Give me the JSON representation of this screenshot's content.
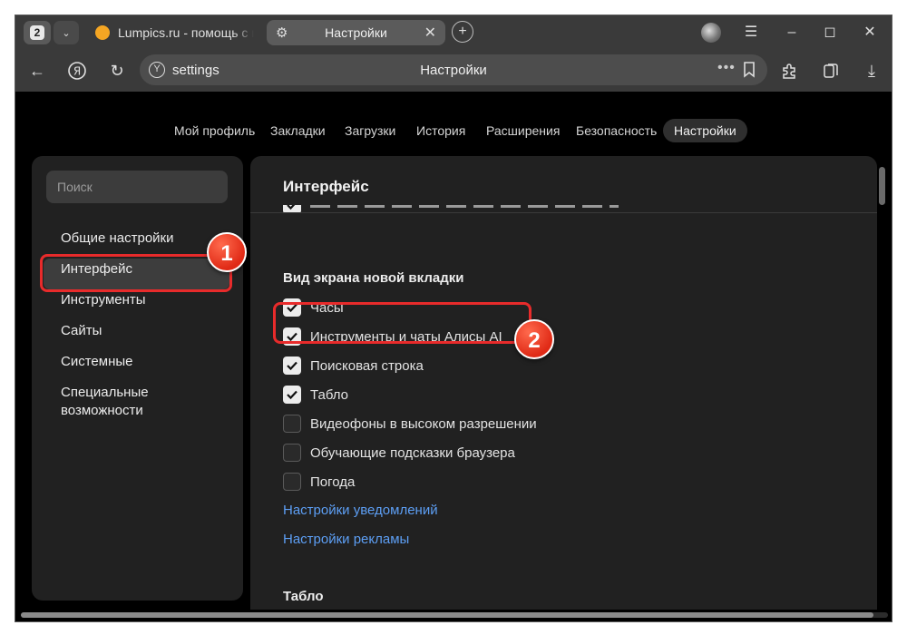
{
  "browser": {
    "tab_count": "2",
    "tabs": [
      {
        "title": "Lumpics.ru - помощь с компьютером",
        "active": false
      },
      {
        "title": "Настройки",
        "active": true
      }
    ],
    "address": {
      "url": "settings",
      "page_title": "Настройки"
    }
  },
  "settings_nav": [
    "Мой профиль",
    "Закладки",
    "Загрузки",
    "История",
    "Расширения",
    "Безопасность",
    "Настройки"
  ],
  "sidebar": {
    "search_placeholder": "Поиск",
    "items": [
      "Общие настройки",
      "Интерфейс",
      "Инструменты",
      "Сайты",
      "Системные",
      "Специальные возможности"
    ],
    "active_index": 1
  },
  "main": {
    "title": "Интерфейс",
    "newtab_section_title": "Вид экрана новой вкладки",
    "options": [
      {
        "label": "Часы",
        "checked": true
      },
      {
        "label": "Инструменты и чаты Алисы AI",
        "checked": true
      },
      {
        "label": "Поисковая строка",
        "checked": true
      },
      {
        "label": "Табло",
        "checked": true
      },
      {
        "label": "Видеофоны в высоком разрешении",
        "checked": false
      },
      {
        "label": "Обучающие подсказки браузера",
        "checked": false
      },
      {
        "label": "Погода",
        "checked": false
      }
    ],
    "links": [
      "Настройки уведомлений",
      "Настройки рекламы"
    ],
    "next_section_title": "Табло"
  },
  "annotations": {
    "badge1": "1",
    "badge2": "2"
  }
}
